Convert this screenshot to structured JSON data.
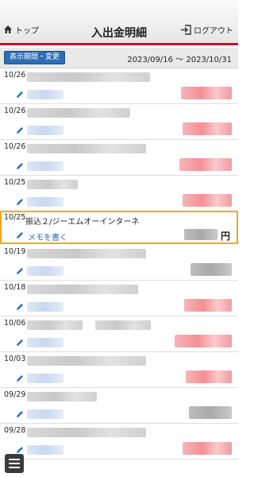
{
  "header": {
    "top_label": "トップ",
    "title": "入出金明細",
    "logout_label": "ログアウト"
  },
  "period": {
    "button_label": "表示期間・変更",
    "range": "2023/09/16 ～ 2023/10/31"
  },
  "rows": [
    {
      "date": "10/26"
    },
    {
      "date": "10/26"
    },
    {
      "date": "10/26"
    },
    {
      "date": "10/25"
    },
    {
      "date": "10/25",
      "description": "振込２/ジーエムオーインターネ",
      "memo_label": "メモを書く",
      "amount_unit": "円"
    },
    {
      "date": "10/19"
    },
    {
      "date": "10/18"
    },
    {
      "date": "10/06"
    },
    {
      "date": "10/03"
    },
    {
      "date": "09/29"
    },
    {
      "date": "09/28"
    }
  ],
  "colors": {
    "accent": "#c8102e",
    "link": "#2d6db5",
    "highlight": "#f5a623"
  },
  "icons": {
    "top": "home-icon",
    "logout": "logout-icon",
    "memo": "pencil-icon",
    "menu": "hamburger-menu-icon"
  }
}
